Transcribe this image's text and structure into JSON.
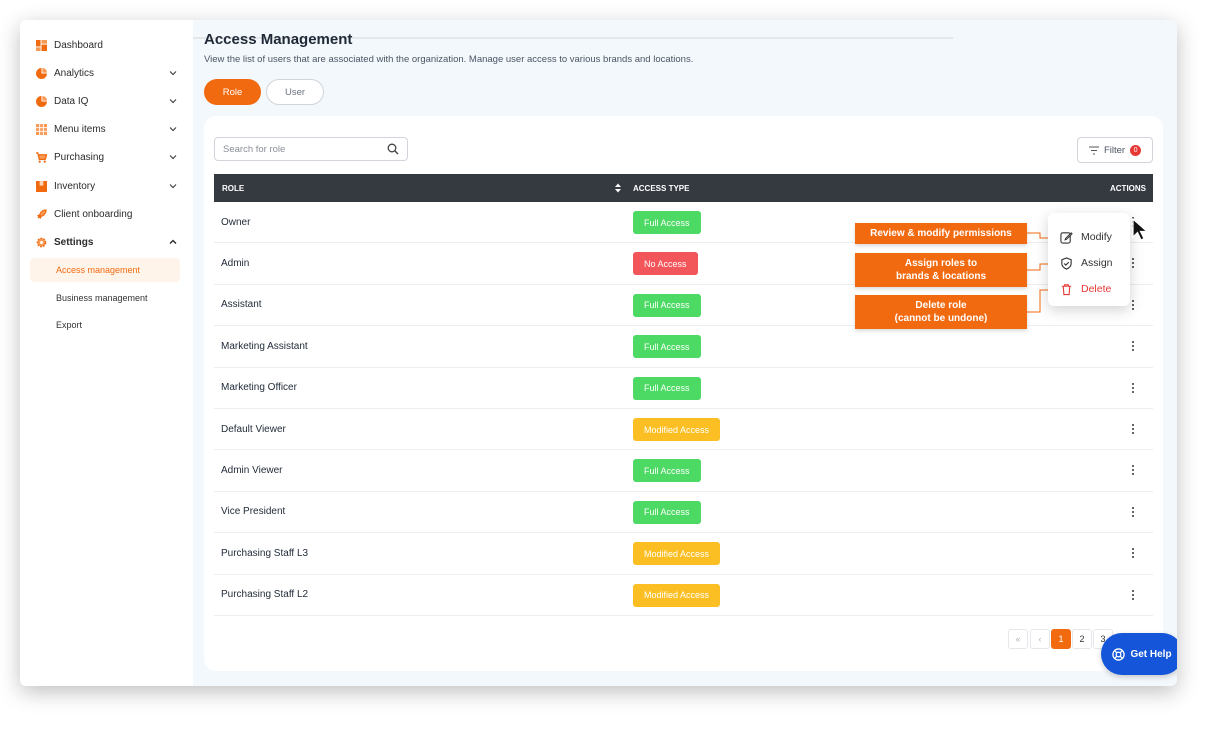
{
  "sidebar": {
    "items": [
      {
        "label": "Dashboard",
        "icon": "dashboard-icon"
      },
      {
        "label": "Analytics",
        "icon": "pie-chart-icon"
      },
      {
        "label": "Data IQ",
        "icon": "pie-chart-icon"
      },
      {
        "label": "Menu items",
        "icon": "grid-icon"
      },
      {
        "label": "Purchasing",
        "icon": "cart-icon"
      },
      {
        "label": "Inventory",
        "icon": "box-icon"
      },
      {
        "label": "Client onboarding",
        "icon": "rocket-icon"
      },
      {
        "label": "Settings",
        "icon": "gear-icon"
      }
    ],
    "subitems": [
      {
        "label": "Access management"
      },
      {
        "label": "Business management"
      },
      {
        "label": "Export"
      }
    ]
  },
  "page": {
    "title": "Access Management",
    "subtitle": "View the list of users that are associated with the organization. Manage user access to various brands and locations."
  },
  "tabs": {
    "role": "Role",
    "user": "User"
  },
  "search": {
    "placeholder": "Search for role"
  },
  "filter": {
    "label": "Filter",
    "count": "0"
  },
  "table": {
    "headers": {
      "role": "ROLE",
      "access_type": "ACCESS TYPE",
      "actions": "ACTIONS"
    },
    "rows": [
      {
        "role": "Owner",
        "access": "Full Access",
        "type": "full"
      },
      {
        "role": "Admin",
        "access": "No Access",
        "type": "none"
      },
      {
        "role": "Assistant",
        "access": "Full Access",
        "type": "full"
      },
      {
        "role": "Marketing Assistant",
        "access": "Full Access",
        "type": "full"
      },
      {
        "role": "Marketing Officer",
        "access": "Full Access",
        "type": "full"
      },
      {
        "role": "Default Viewer",
        "access": "Modified Access",
        "type": "modified"
      },
      {
        "role": "Admin Viewer",
        "access": "Full Access",
        "type": "full"
      },
      {
        "role": "Vice President",
        "access": "Full Access",
        "type": "full"
      },
      {
        "role": "Purchasing Staff L3",
        "access": "Modified Access",
        "type": "modified"
      },
      {
        "role": "Purchasing Staff L2",
        "access": "Modified Access",
        "type": "modified"
      }
    ]
  },
  "access_colors": {
    "full": "#4cd964",
    "none": "#f2555a",
    "modified": "#fbbf24"
  },
  "pagination": {
    "first": "«",
    "prev": "‹",
    "pages": [
      "1",
      "2",
      "3"
    ],
    "current": "1"
  },
  "help": {
    "label": "Get Help"
  },
  "action_menu": {
    "modify": "Modify",
    "assign": "Assign",
    "delete": "Delete"
  },
  "callouts": {
    "modify": "Review & modify permissions",
    "assign_line1": "Assign roles to",
    "assign_line2": "brands & locations",
    "delete_line1": "Delete role",
    "delete_line2": "(cannot be undone)"
  },
  "colors": {
    "accent": "#f26a10",
    "header": "#343a40",
    "help": "#1455d9",
    "danger": "#e53935"
  }
}
